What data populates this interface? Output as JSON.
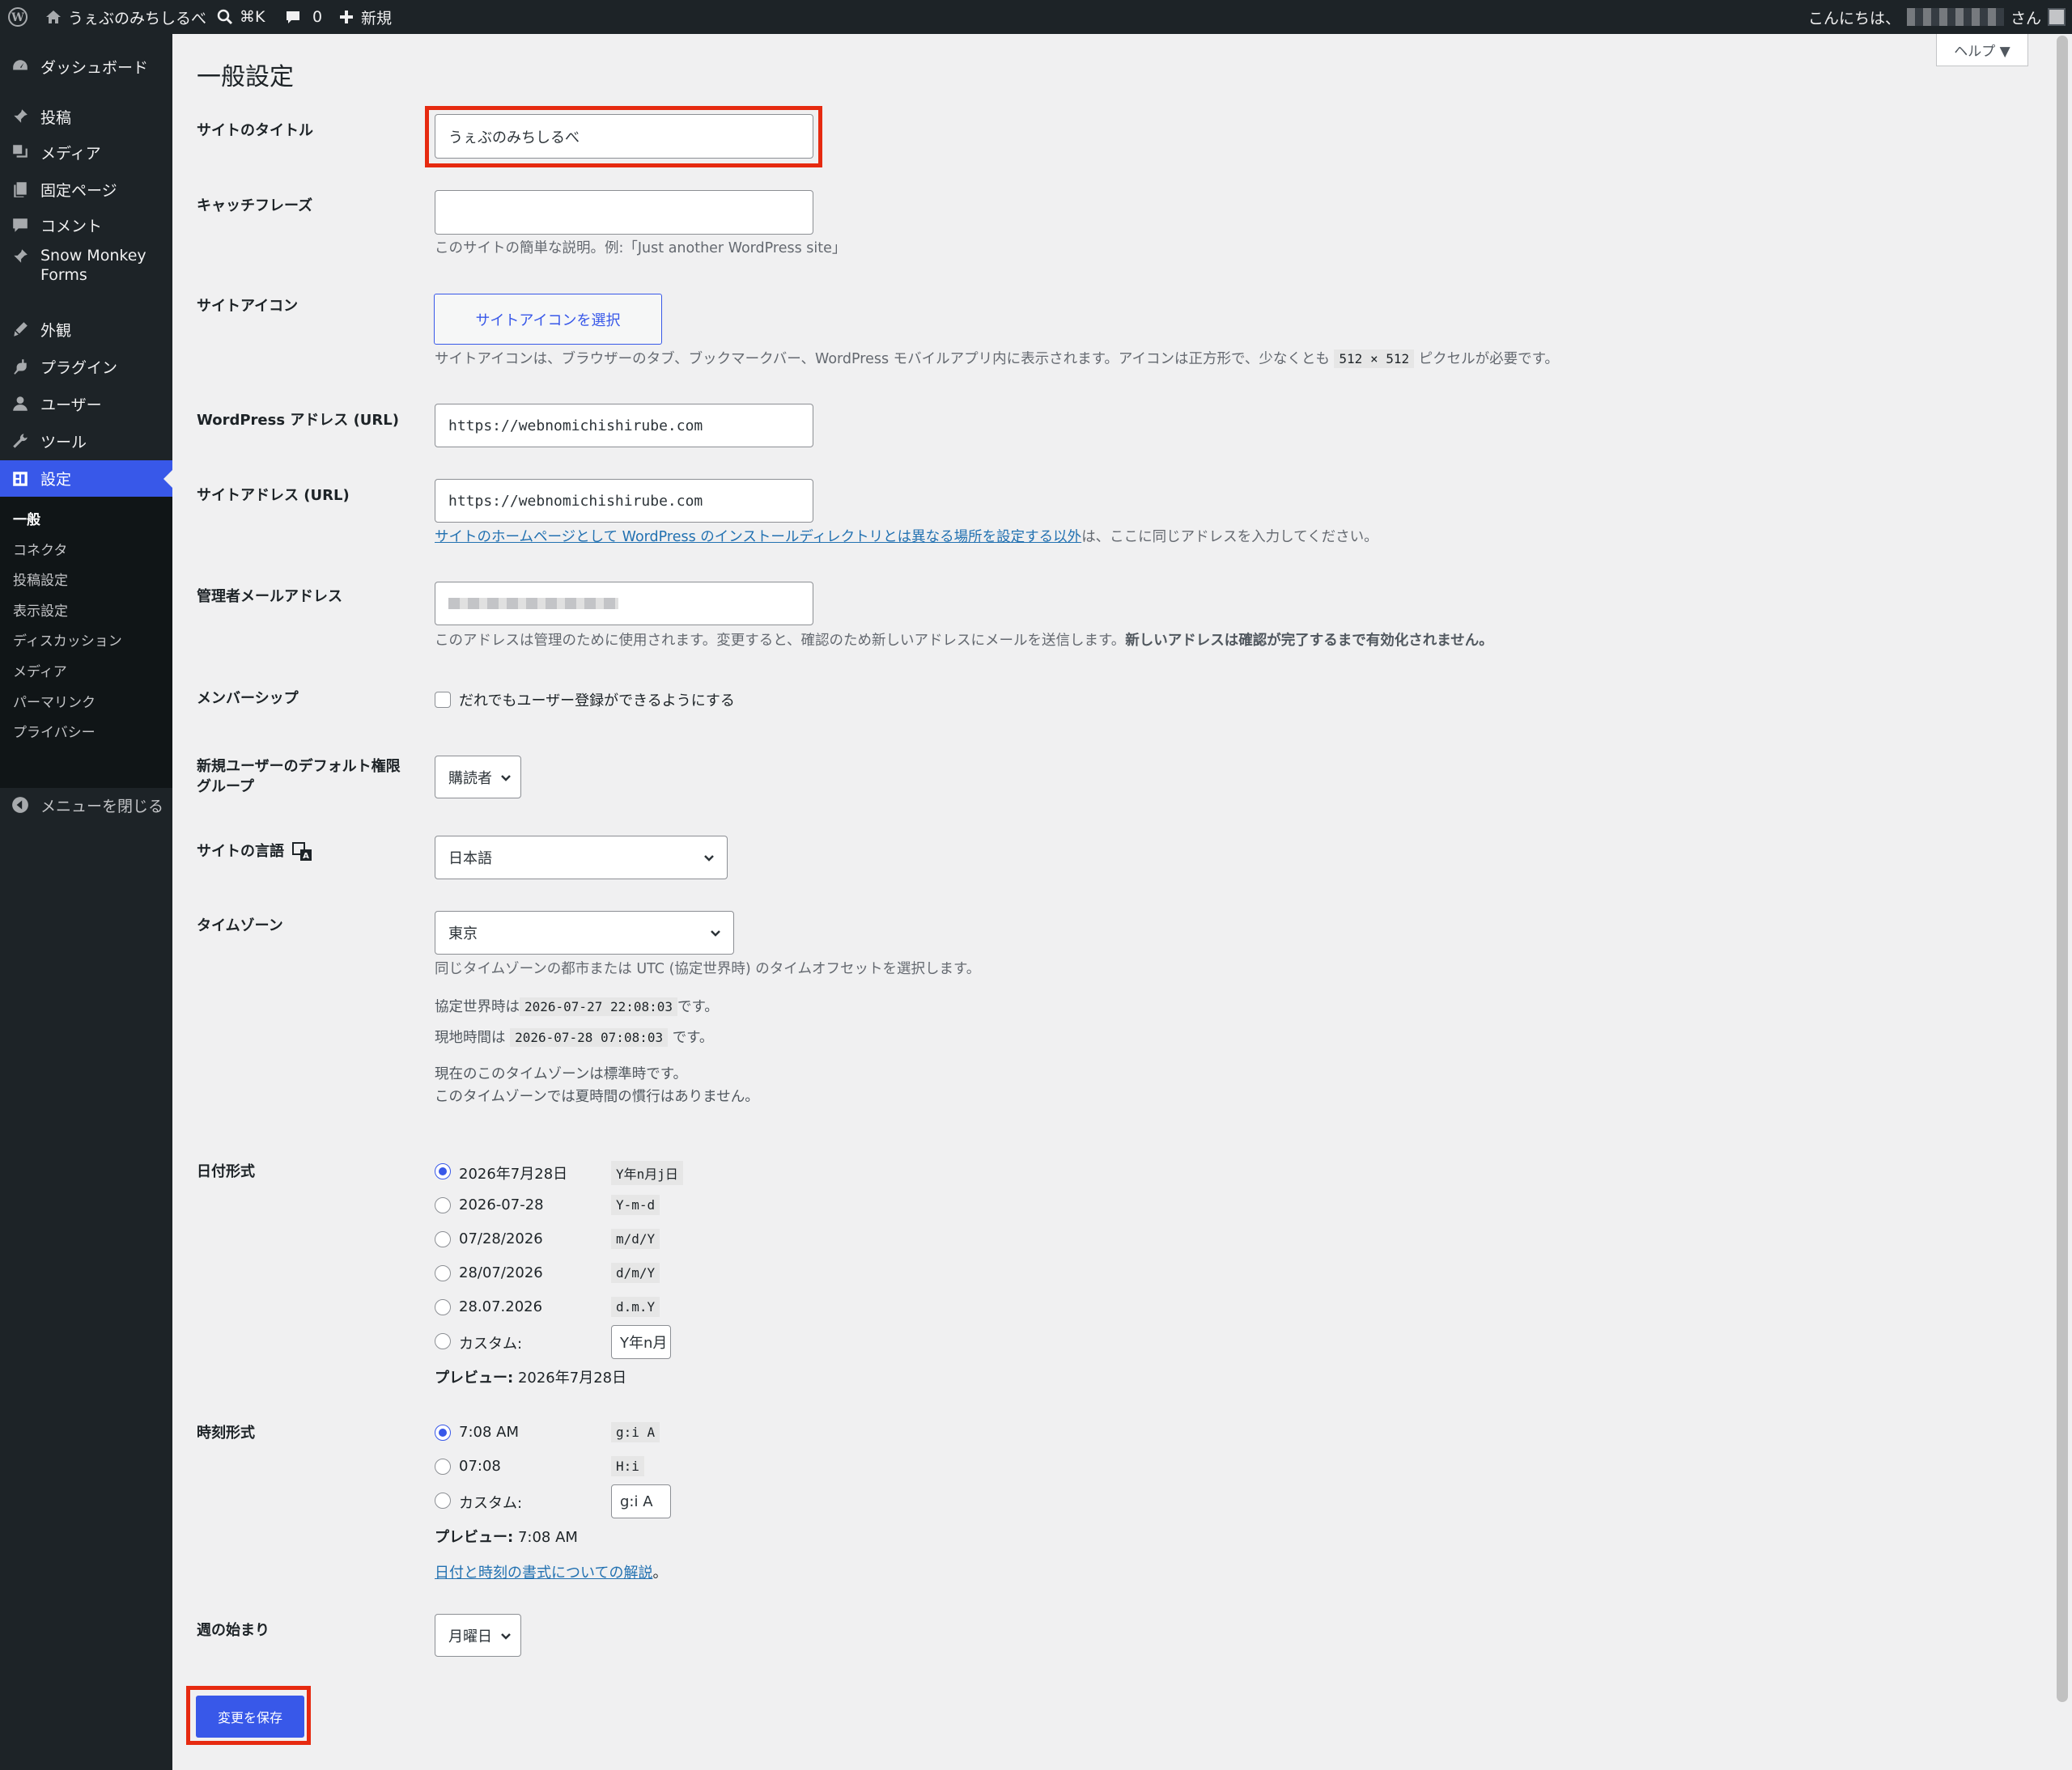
{
  "adminbar": {
    "site_name": "うぇぶのみちしるべ",
    "search_shortcut": "⌘K",
    "comments_count": "0",
    "new_label": "新規",
    "greeting": "こんにちは、",
    "greeting_suffix": "さん"
  },
  "sidebar": {
    "items": [
      {
        "label": "ダッシュボード",
        "icon": "dashboard-icon"
      },
      {
        "label": "投稿",
        "icon": "pin-icon"
      },
      {
        "label": "メディア",
        "icon": "media-icon"
      },
      {
        "label": "固定ページ",
        "icon": "page-icon"
      },
      {
        "label": "コメント",
        "icon": "comment-icon"
      },
      {
        "label": "Snow Monkey",
        "label2": "Forms",
        "icon": "pin-icon"
      },
      {
        "label": "外観",
        "icon": "brush-icon"
      },
      {
        "label": "プラグイン",
        "icon": "plugin-icon"
      },
      {
        "label": "ユーザー",
        "icon": "user-icon"
      },
      {
        "label": "ツール",
        "icon": "wrench-icon"
      },
      {
        "label": "設定",
        "icon": "settings-icon"
      }
    ],
    "submenu": [
      "一般",
      "コネクタ",
      "投稿設定",
      "表示設定",
      "ディスカッション",
      "メディア",
      "パーマリンク",
      "プライバシー"
    ],
    "collapse_label": "メニューを閉じる"
  },
  "page": {
    "title": "一般設定",
    "help_label": "ヘルプ ▼"
  },
  "form": {
    "site_title_label": "サイトのタイトル",
    "site_title_value": "うぇぶのみちしるべ",
    "tagline_label": "キャッチフレーズ",
    "tagline_value": "",
    "tagline_desc": "このサイトの簡単な説明。例:「Just another WordPress site」",
    "site_icon_label": "サイトアイコン",
    "site_icon_button": "サイトアイコンを選択",
    "site_icon_desc_a": "サイトアイコンは、ブラウザーのタブ、ブックマークバー、WordPress モバイルアプリ内に表示されます。アイコンは正方形で、少なくとも",
    "site_icon_size": "512 × 512",
    "site_icon_desc_b": "ピクセルが必要です。",
    "wp_url_label": "WordPress アドレス (URL)",
    "wp_url_value": "https://webnomichishirube.com",
    "site_url_label": "サイトアドレス (URL)",
    "site_url_value": "https://webnomichishirube.com",
    "site_url_link": "サイトのホームページとして WordPress のインストールディレクトリとは異なる場所を設定する以外",
    "site_url_desc": "は、ここに同じアドレスを入力してください。",
    "admin_email_label": "管理者メールアドレス",
    "admin_email_desc_a": "このアドレスは管理のために使用されます。変更すると、確認のため新しいアドレスにメールを送信します。",
    "admin_email_desc_b": "新しいアドレスは確認が完了するまで有効化されません。",
    "membership_label": "メンバーシップ",
    "membership_checkbox": "だれでもユーザー登録ができるようにする",
    "default_role_label_1": "新規ユーザーのデフォルト権限",
    "default_role_label_2": "グループ",
    "default_role_value": "購読者",
    "language_label": "サイトの言語",
    "language_value": "日本語",
    "timezone_label": "タイムゾーン",
    "timezone_value": "東京",
    "timezone_desc": "同じタイムゾーンの都市または UTC (協定世界時) のタイムオフセットを選択します。",
    "utc_prefix": "協定世界時は",
    "utc_time": "2026-07-27 22:08:03",
    "utc_suffix": "です。",
    "local_prefix": "現地時間は",
    "local_time": "2026-07-28 07:08:03",
    "local_suffix": "です。",
    "tz_note_1": "現在のこのタイムゾーンは標準時です。",
    "tz_note_2": "このタイムゾーンでは夏時間の慣行はありません。",
    "date_format_label": "日付形式",
    "date_formats": [
      {
        "label": "2026年7月28日",
        "code": "Y年n月j日",
        "checked": true
      },
      {
        "label": "2026-07-28",
        "code": "Y-m-d",
        "checked": false
      },
      {
        "label": "07/28/2026",
        "code": "m/d/Y",
        "checked": false
      },
      {
        "label": "28/07/2026",
        "code": "d/m/Y",
        "checked": false
      },
      {
        "label": "28.07.2026",
        "code": "d.m.Y",
        "checked": false
      }
    ],
    "custom_label": "カスタム:",
    "date_custom_value": "Y年n月",
    "preview_label": "プレビュー:",
    "date_preview": "2026年7月28日",
    "time_format_label": "時刻形式",
    "time_formats": [
      {
        "label": "7:08 AM",
        "code": "g:i A",
        "checked": true
      },
      {
        "label": "07:08",
        "code": "H:i",
        "checked": false
      }
    ],
    "time_custom_value": "g:i A",
    "time_preview": "7:08 AM",
    "format_doc_link": "日付と時刻の書式についての解説",
    "format_doc_suffix": "。",
    "week_start_label": "週の始まり",
    "week_start_value": "月曜日",
    "save_button": "変更を保存"
  },
  "colors": {
    "accent": "#3858e9",
    "highlight": "#e62a10",
    "sidebar": "#1d2327"
  }
}
